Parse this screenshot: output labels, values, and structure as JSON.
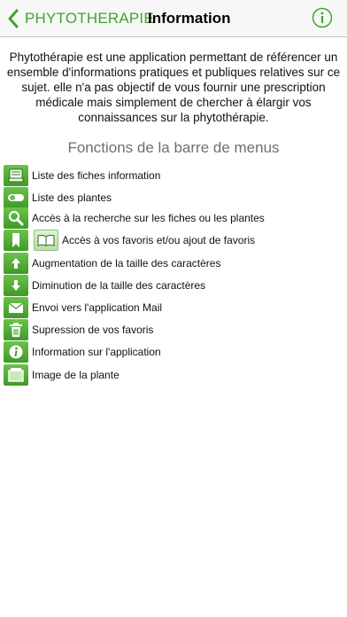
{
  "navbar": {
    "back_label": "PHYTOTHERAPIE",
    "title": "Information"
  },
  "intro": {
    "text": "Phytothérapie est une application permettant de référencer un ensemble d'informations pratiques et publiques relatives sur ce sujet. elle n'a pas objectif de vous fournir une prescription médicale mais simplement de chercher à élargir vos connaissances sur la phytothérapie."
  },
  "functions": {
    "title": "Fonctions de la barre de menus",
    "items": [
      {
        "icon": "list-fiches-icon",
        "label": "Liste des fiches information"
      },
      {
        "icon": "list-plantes-icon",
        "label": "Liste des plantes"
      },
      {
        "icon": "search-icon",
        "label": "Accès à la recherche sur les fiches ou les plantes"
      },
      {
        "icon": "bookmark-icon",
        "label": "Accès à vos favoris et/ou ajout de favoris"
      },
      {
        "icon": "arrow-up-icon",
        "label": "Augmentation de la taille des caractères"
      },
      {
        "icon": "arrow-down-icon",
        "label": "Diminution de la taille des caractères"
      },
      {
        "icon": "mail-icon",
        "label": "Envoi vers l'application Mail"
      },
      {
        "icon": "trash-icon",
        "label": "Supression de vos favoris"
      },
      {
        "icon": "info-icon",
        "label": "Information sur l'application"
      },
      {
        "icon": "image-icon",
        "label": "Image de la plante"
      }
    ]
  },
  "colors": {
    "accent": "#3fa52a",
    "icon_green_top": "#6cc24a",
    "icon_green_bottom": "#3e9a26",
    "section_title": "#6f6f6f"
  }
}
